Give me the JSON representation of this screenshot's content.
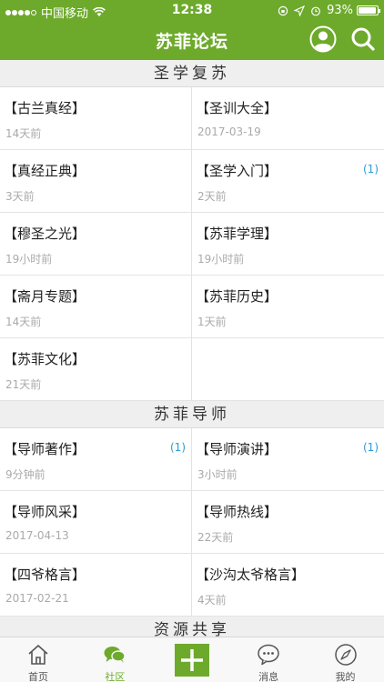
{
  "status_bar": {
    "carrier": "中国移动",
    "time": "12:38",
    "battery": "93%",
    "battery_level": 0.93,
    "signal_bars_filled": 4,
    "signal_bars_total": 5
  },
  "header": {
    "title": "苏菲论坛",
    "icons": [
      "user-icon",
      "search-icon"
    ]
  },
  "colors": {
    "brand": "#6daa2b",
    "badge": "#2f9bd6"
  },
  "sections": [
    {
      "title": "圣学复苏",
      "items": [
        {
          "name": "【古兰真经】",
          "time": "14天前",
          "badge": ""
        },
        {
          "name": "【圣训大全】",
          "time": "2017-03-19",
          "badge": ""
        },
        {
          "name": "【真经正典】",
          "time": "3天前",
          "badge": ""
        },
        {
          "name": "【圣学入门】",
          "time": "2天前",
          "badge": "(1)"
        },
        {
          "name": "【穆圣之光】",
          "time": "19小时前",
          "badge": ""
        },
        {
          "name": "【苏菲学理】",
          "time": "19小时前",
          "badge": ""
        },
        {
          "name": "【斋月专题】",
          "time": "14天前",
          "badge": ""
        },
        {
          "name": "【苏菲历史】",
          "time": "1天前",
          "badge": ""
        },
        {
          "name": "【苏菲文化】",
          "time": "21天前",
          "badge": ""
        },
        {
          "name": "",
          "time": "",
          "badge": ""
        }
      ]
    },
    {
      "title": "苏菲导师",
      "items": [
        {
          "name": "【导师著作】",
          "time": "9分钟前",
          "badge": "(1)"
        },
        {
          "name": "【导师演讲】",
          "time": "3小时前",
          "badge": "(1)"
        },
        {
          "name": "【导师风采】",
          "time": "2017-04-13",
          "badge": ""
        },
        {
          "name": "【导师热线】",
          "time": "22天前",
          "badge": ""
        },
        {
          "name": "【四爷格言】",
          "time": "2017-02-21",
          "badge": ""
        },
        {
          "name": "【沙沟太爷格言】",
          "time": "4天前",
          "badge": ""
        }
      ]
    },
    {
      "title": "资源共享",
      "items": []
    }
  ],
  "tabbar": {
    "active": 1,
    "tabs": [
      {
        "label": "首页",
        "icon": "home-icon"
      },
      {
        "label": "社区",
        "icon": "community-chat-icon"
      },
      {
        "label": "",
        "icon": "add-icon"
      },
      {
        "label": "消息",
        "icon": "message-icon"
      },
      {
        "label": "我的",
        "icon": "compass-icon"
      }
    ]
  }
}
